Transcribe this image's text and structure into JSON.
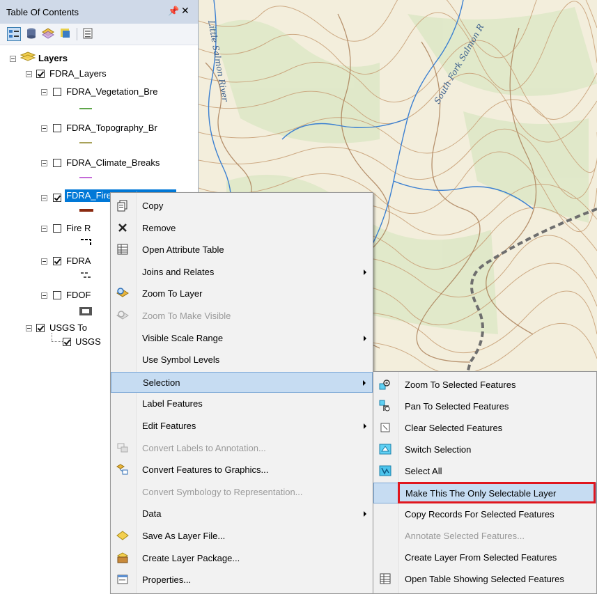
{
  "toc": {
    "title": "Table Of Contents",
    "pin_glyph": "p",
    "close_glyph": "×",
    "toolbar": [
      "list-by-drawing-order-icon",
      "list-by-source-icon",
      "list-by-visibility-icon",
      "list-by-selection-icon",
      "options-icon"
    ],
    "tree": {
      "root": "Layers",
      "group": "FDRA_Layers",
      "layers": [
        {
          "label": "FDRA_Vegetation_Bre",
          "checked": false,
          "symbol_color": "#5fa64a"
        },
        {
          "label": "FDRA_Topography_Br",
          "checked": false,
          "symbol_color": "#a8a25a"
        },
        {
          "label": "FDRA_Climate_Breaks",
          "checked": false,
          "symbol_color": "#c46ad8"
        },
        {
          "label": "FDRA_Fire_Breaks",
          "checked": true,
          "symbol_color": "#8b2a10"
        },
        {
          "label": "Fire R",
          "checked": false
        },
        {
          "label": "FDRA",
          "checked": true
        },
        {
          "label": "FDOF",
          "checked": false
        }
      ],
      "group2": "USGS To",
      "sublayer": "USGS"
    }
  },
  "context_menu": {
    "items": [
      {
        "label": "Copy",
        "icon": "copy-icon"
      },
      {
        "label": "Remove",
        "icon": "remove-x-icon"
      },
      {
        "label": "Open Attribute Table",
        "icon": "table-icon"
      },
      {
        "label": "Joins and Relates",
        "submenu": true
      },
      {
        "label": "Zoom To Layer",
        "icon": "zoom-to-layer-icon"
      },
      {
        "label": "Zoom To Make Visible",
        "icon": "zoom-visible-icon",
        "disabled": true
      },
      {
        "label": "Visible Scale Range",
        "submenu": true
      },
      {
        "label": "Use Symbol Levels"
      },
      {
        "label": "Selection",
        "submenu": true,
        "highlighted": true
      },
      {
        "label": "Label Features"
      },
      {
        "label": "Edit Features",
        "submenu": true
      },
      {
        "label": "Convert Labels to Annotation...",
        "icon": "convert-labels-icon",
        "disabled": true
      },
      {
        "label": "Convert Features to Graphics...",
        "icon": "convert-graphics-icon"
      },
      {
        "label": "Convert Symbology to Representation...",
        "disabled": true
      },
      {
        "label": "Data",
        "submenu": true
      },
      {
        "label": "Save As Layer File...",
        "icon": "layer-file-icon"
      },
      {
        "label": "Create Layer Package...",
        "icon": "layer-package-icon"
      },
      {
        "label": "Properties...",
        "icon": "properties-icon"
      }
    ]
  },
  "selection_submenu": {
    "items": [
      {
        "label": "Zoom To Selected Features",
        "icon": "zoom-selected-icon"
      },
      {
        "label": "Pan To Selected Features",
        "icon": "pan-selected-icon"
      },
      {
        "label": "Clear Selected Features",
        "icon": "clear-selection-icon"
      },
      {
        "label": "Switch Selection",
        "icon": "switch-selection-icon"
      },
      {
        "label": "Select All",
        "icon": "select-all-icon"
      },
      {
        "label": "Make This The Only Selectable Layer",
        "highlighted": true
      },
      {
        "label": "Copy Records For Selected Features"
      },
      {
        "label": "Annotate Selected Features...",
        "disabled": true
      },
      {
        "label": "Create Layer From Selected Features"
      },
      {
        "label": "Open Table Showing Selected Features",
        "icon": "table-icon"
      }
    ]
  },
  "map": {
    "labels": [
      "Little Salmon River",
      "South Fork Salmon R"
    ]
  },
  "colors": {
    "highlight_box": "#e0161e",
    "menu_hover": "#c6dcf2",
    "selected_layer": "#0078d7"
  }
}
